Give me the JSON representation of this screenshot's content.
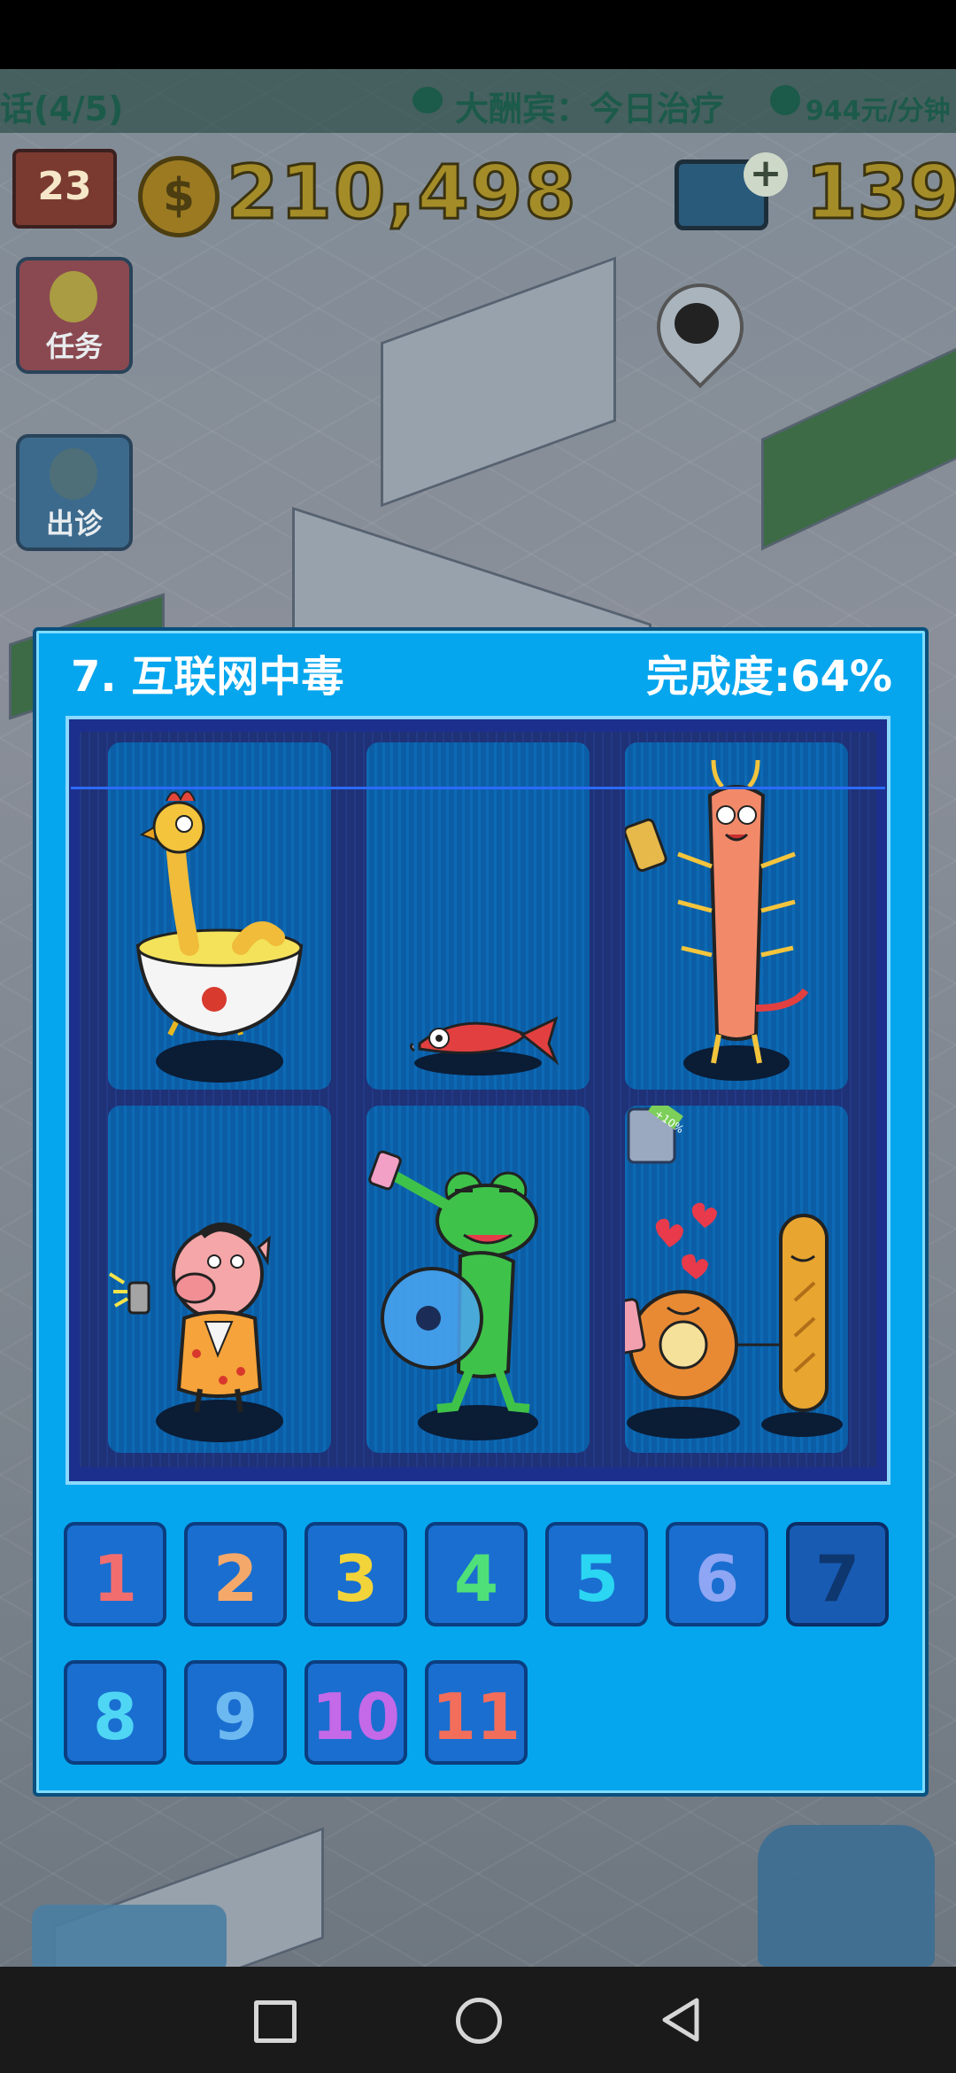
{
  "ticker": {
    "left_text": "话(4/5)",
    "mid_text": "大酬宾：今日治疗",
    "rate_text": "944元/分钟"
  },
  "hud": {
    "level": "23",
    "coin_symbol": "$",
    "money": "210,498",
    "plus": "+",
    "count": "139"
  },
  "side_buttons": {
    "task_label": "任务",
    "visit_label": "出诊"
  },
  "puzzle": {
    "title": "7. 互联网中毒",
    "progress": "完成度:64%",
    "cards": [
      {
        "subject": "chicken-in-soup-bowl"
      },
      {
        "subject": "fish"
      },
      {
        "subject": "shrimp-with-phone"
      },
      {
        "subject": "pig-with-phone"
      },
      {
        "subject": "frog-with-fishbowl"
      },
      {
        "subject": "donut-and-baguette",
        "badge": "+10%"
      }
    ]
  },
  "levels": [
    {
      "label": "1",
      "color": "#f26e6e",
      "selected": false
    },
    {
      "label": "2",
      "color": "#f4a96b",
      "selected": false
    },
    {
      "label": "3",
      "color": "#f2d43a",
      "selected": false
    },
    {
      "label": "4",
      "color": "#4fe07a",
      "selected": false
    },
    {
      "label": "5",
      "color": "#2ad6f2",
      "selected": false
    },
    {
      "label": "6",
      "color": "#8ea6f4",
      "selected": false
    },
    {
      "label": "7",
      "color": "#0e3770",
      "selected": true
    },
    {
      "label": "8",
      "color": "#4fd6f4",
      "selected": false
    },
    {
      "label": "9",
      "color": "#6cb8f0",
      "selected": false
    },
    {
      "label": "10",
      "color": "#c469e8",
      "selected": false
    },
    {
      "label": "11",
      "color": "#f26e5a",
      "selected": false
    }
  ],
  "colors": {
    "panel_bg": "#06a6ee",
    "board_bg": "#1c2f8c",
    "card_bg": "#0b5ea6"
  }
}
